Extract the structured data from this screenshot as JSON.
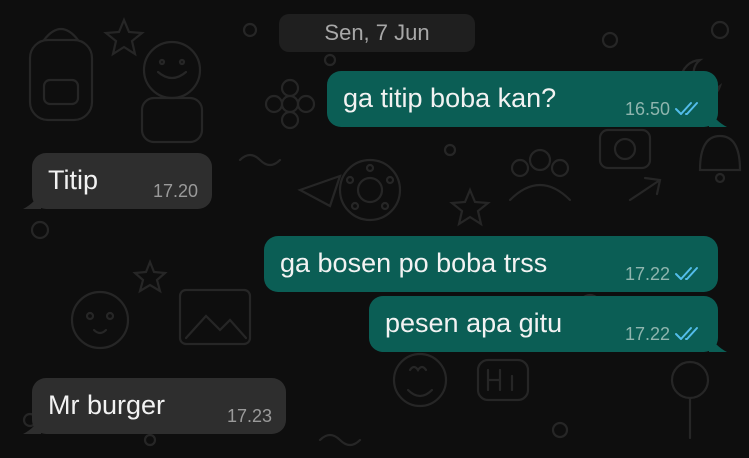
{
  "date_separator": "Sen, 7 Jun",
  "messages": [
    {
      "direction": "out",
      "text": "ga titip boba kan?",
      "time": "16.50",
      "status_icon": "double-check-read-icon"
    },
    {
      "direction": "in",
      "text": "Titip",
      "time": "17.20"
    },
    {
      "direction": "out",
      "text": "ga bosen po boba trss",
      "time": "17.22",
      "status_icon": "double-check-read-icon"
    },
    {
      "direction": "out",
      "text": "pesen apa gitu",
      "time": "17.22",
      "status_icon": "double-check-read-icon"
    },
    {
      "direction": "in",
      "text": "Mr burger",
      "time": "17.23"
    }
  ],
  "colors": {
    "outgoing_bubble": "#0b5e55",
    "incoming_bubble": "#2e2e2e",
    "read_tick": "#53bdeb",
    "background": "#0e0e0e"
  }
}
